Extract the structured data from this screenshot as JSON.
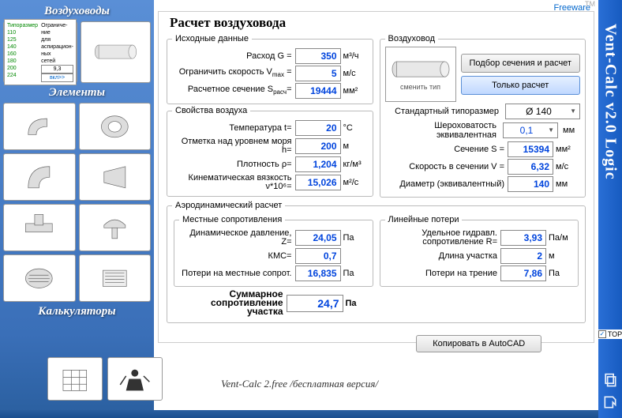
{
  "freeware": "Freeware",
  "tm": "TM",
  "right_title": "Vent-Calc v2.0 Logic",
  "top_label": "TOP",
  "sidebar": {
    "ducts_header": "Воздуховоды",
    "elements_header": "Элементы",
    "calcs_header": "Калькуляторы"
  },
  "main": {
    "title": "Расчет воздуховода",
    "input_legend": "Исходные данные",
    "flow_label": "Расход G =",
    "flow_val": "350",
    "flow_unit": "м³/ч",
    "vmax_label": "Ограничить скорость V",
    "vmax_sub": "max",
    "vmax_eq": " =",
    "vmax_val": "5",
    "vmax_unit": "м/с",
    "section_label": "Расчетное сечение S",
    "section_sub": "расч",
    "section_eq": "=",
    "section_val": "19444",
    "section_unit": "мм²",
    "air_legend": "Свойства воздуха",
    "temp_label": "Температура t=",
    "temp_val": "20",
    "temp_unit": "°C",
    "alt_label": "Отметка над уровнем моря h=",
    "alt_val": "200",
    "alt_unit": "м",
    "dens_label": "Плотность ρ=",
    "dens_val": "1,204",
    "dens_unit": "кг/м³",
    "visc_label": "Кинематическая вязкость ν*10⁶=",
    "visc_val": "15,026",
    "visc_unit": "м²/с",
    "duct_legend": "Воздуховод",
    "change_type": "сменить тип",
    "btn_pick": "Подбор сечения и расчет",
    "btn_calc": "Только расчет",
    "std_label": "Стандартный типоразмер",
    "std_val": "Ø 140",
    "rough_label": "Шероховатость эквивалентная",
    "rough_val": "0,1",
    "rough_unit": "мм",
    "s_label": "Сечение S =",
    "s_val": "15394",
    "s_unit": "мм²",
    "v_label": "Скорость в сечении V =",
    "v_val": "6,32",
    "v_unit": "м/с",
    "d_label": "Диаметр (эквивалентный)",
    "d_val": "140",
    "d_unit": "мм",
    "aero_legend": "Аэродинамический расчет",
    "local_legend": "Местные сопротивления",
    "dynp_label": "Динамическое давление, Z=",
    "dynp_val": "24,05",
    "dynp_unit": "Па",
    "kmc_label": "КМС=",
    "kmc_val": "0,7",
    "loss_local_label": "Потери на местные сопрот.",
    "loss_local_val": "16,835",
    "loss_local_unit": "Па",
    "lin_legend": "Линейные потери",
    "r_label": "Удельное гидравл. сопротивление R=",
    "r_val": "3,93",
    "r_unit": "Па/м",
    "len_label": "Длина участка",
    "len_val": "2",
    "len_unit": "м",
    "fric_label": "Потери на трение",
    "fric_val": "7,86",
    "fric_unit": "Па",
    "sum_label": "Суммарное сопротивление участка",
    "sum_val": "24,7",
    "sum_unit": "Па",
    "copy_btn": "Копировать в AutoCAD"
  },
  "footer": "Vent-Calc 2.free /бесплатная версия/"
}
